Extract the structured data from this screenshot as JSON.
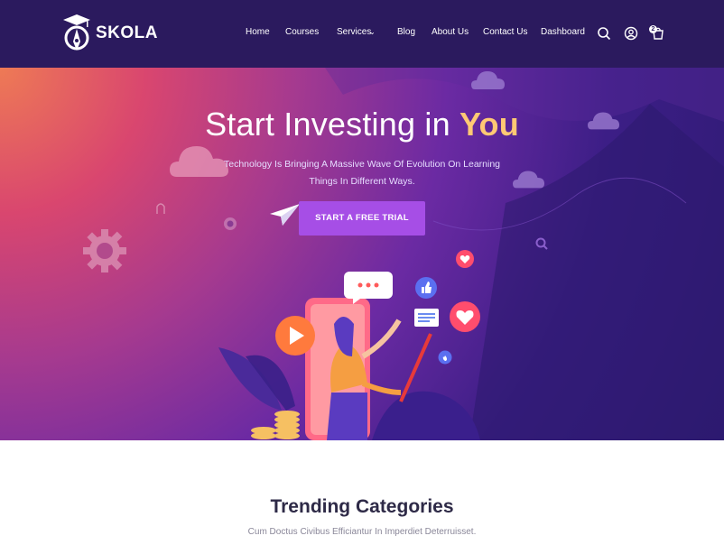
{
  "brand": {
    "name": "SKOLA"
  },
  "nav": {
    "items": [
      {
        "label": "Home"
      },
      {
        "label": "Courses"
      },
      {
        "label": "Services"
      },
      {
        "label": "Blog"
      },
      {
        "label": "About Us"
      },
      {
        "label": "Contact Us"
      },
      {
        "label": "Dashboard"
      }
    ],
    "cart_count": "2",
    "icons": [
      "search-icon",
      "user-icon",
      "cart-icon"
    ]
  },
  "hero": {
    "title_start": "Start Investing in",
    "title_highlight": "You",
    "subtitle_line1": "Technology Is Bringing A Massive Wave Of Evolution On Learning",
    "subtitle_line2": "Things In Different Ways.",
    "cta_label": "START A FREE TRIAL"
  },
  "trending": {
    "title": "Trending Categories",
    "subtitle": "Cum Doctus Civibus Efficiantur In Imperdiet Deterruisset."
  },
  "colors": {
    "nav_bg": "#2b1a5e",
    "highlight": "#ffc974",
    "cta_bg": "#a64ee6"
  }
}
